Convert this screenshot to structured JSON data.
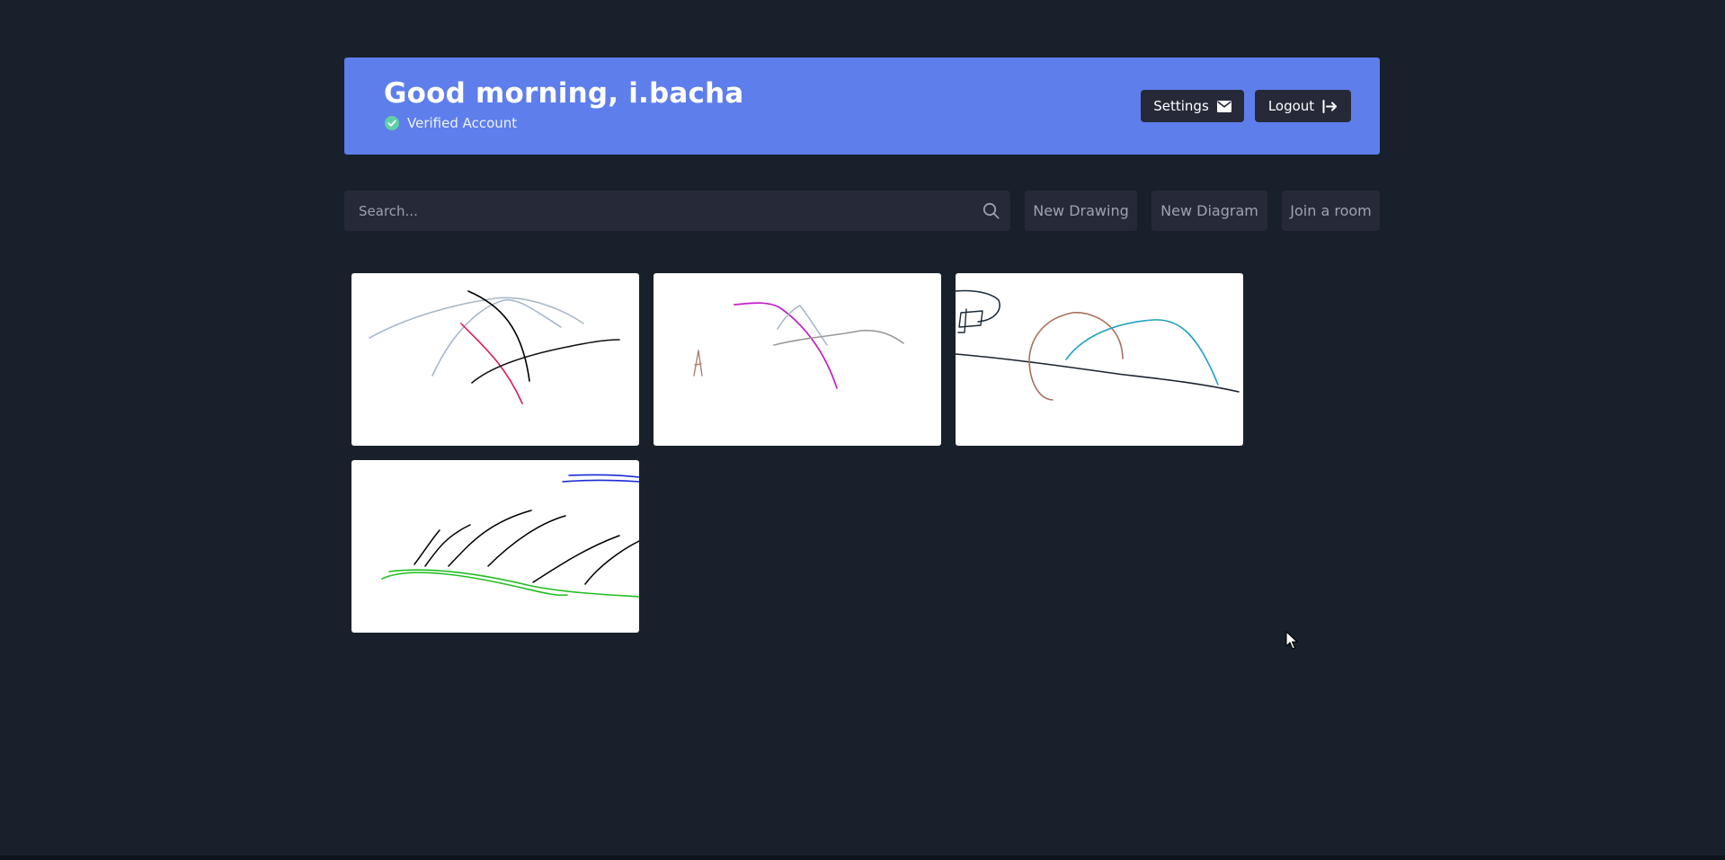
{
  "header": {
    "greeting": "Good morning, i.bacha",
    "verified_label": "Verified Account",
    "settings_label": "Settings",
    "logout_label": "Logout",
    "background_color": "#5e7eec"
  },
  "toolbar": {
    "search_placeholder": "Search...",
    "search_value": "",
    "new_drawing_label": "New Drawing",
    "new_diagram_label": "New Diagram",
    "join_room_label": "Join a room"
  },
  "drawings": [
    {
      "stroke_colors": [
        "#a9b7c9",
        "#000000",
        "#e0175d",
        "#111111"
      ]
    },
    {
      "stroke_colors": [
        "#c21ec6",
        "#a9b7c9",
        "#999999",
        "#b08070"
      ]
    },
    {
      "stroke_colors": [
        "#1a2a38",
        "#a86f5a",
        "#1ea0c0",
        "#1a2330"
      ]
    },
    {
      "stroke_colors": [
        "#000000",
        "#1fbf1f",
        "#1a2bd6"
      ]
    }
  ],
  "icons": {
    "verified": "check-circle-icon",
    "settings": "envelope-icon",
    "logout": "sign-out-icon",
    "search": "search-icon"
  },
  "colors": {
    "page_background": "#18202b",
    "button_background": "#262a38",
    "verified_check": "#5fd0a6"
  }
}
